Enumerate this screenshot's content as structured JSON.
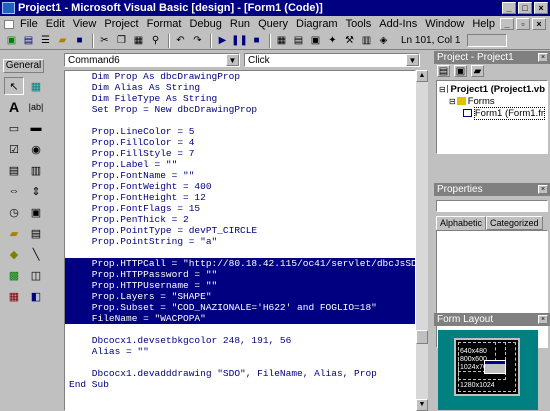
{
  "window": {
    "title": "Project1 - Microsoft Visual Basic [design] - [Form1 (Code)]"
  },
  "menu": [
    "File",
    "Edit",
    "View",
    "Project",
    "Format",
    "Debug",
    "Run",
    "Query",
    "Diagram",
    "Tools",
    "Add-Ins",
    "Window",
    "Help"
  ],
  "toolbar": {
    "position": "Ln 101, Col 1"
  },
  "toolbox": {
    "title": "General"
  },
  "code": {
    "object_combo": "Command6",
    "proc_combo": "Click",
    "lines": [
      "    Dim Prop As dbcDrawingProp",
      "    Dim Alias As String",
      "    Dim FileType As String",
      "    Set Prop = New dbcDrawingProp",
      "",
      "    Prop.LineColor = 5",
      "    Prop.FillColor = 4",
      "    Prop.FillStyle = 7",
      "    Prop.Label = \"\"",
      "    Prop.FontName = \"\"",
      "    Prop.FontWeight = 400",
      "    Prop.FontHeight = 12",
      "    Prop.FontFlags = 15",
      "    Prop.PenThick = 2",
      "    Prop.PointType = devPT_CIRCLE",
      "    Prop.PointString = \"a\"",
      "",
      "    Prop.HTTPCall = \"http://80.18.42.115/oc41/servlet/dbcJsSD",
      "    Prop.HTTPPassword = \"\"",
      "    Prop.HTTPUsername = \"\"",
      "    Prop.Layers = \"SHAPE\"",
      "    Prop.Subset = \"COD_NAZIONALE='H622' and FOGLIO=18\"",
      "    FileName = \"WACPOPA\"",
      "",
      "    Dbcocx1.devsetbkgcolor 248, 191, 56",
      "    Alias = \"\"",
      "",
      "    Dbcocx1.devadddrawing \"SDO\", FileName, Alias, Prop",
      "End Sub"
    ],
    "selected_lines": [
      17,
      18,
      19,
      20,
      21,
      22
    ]
  },
  "project": {
    "title": "Project - Project1",
    "tree": [
      "Project1 (Project1.vb",
      "Forms",
      "Form1 (Form1.fr"
    ]
  },
  "properties": {
    "title": "Properties",
    "tabs": [
      "Alphabetic",
      "Categorized"
    ]
  },
  "form_layout": {
    "title": "Form Layout",
    "resolutions": [
      "640x480",
      "800x600",
      "1024x768",
      "1280x1024"
    ]
  }
}
